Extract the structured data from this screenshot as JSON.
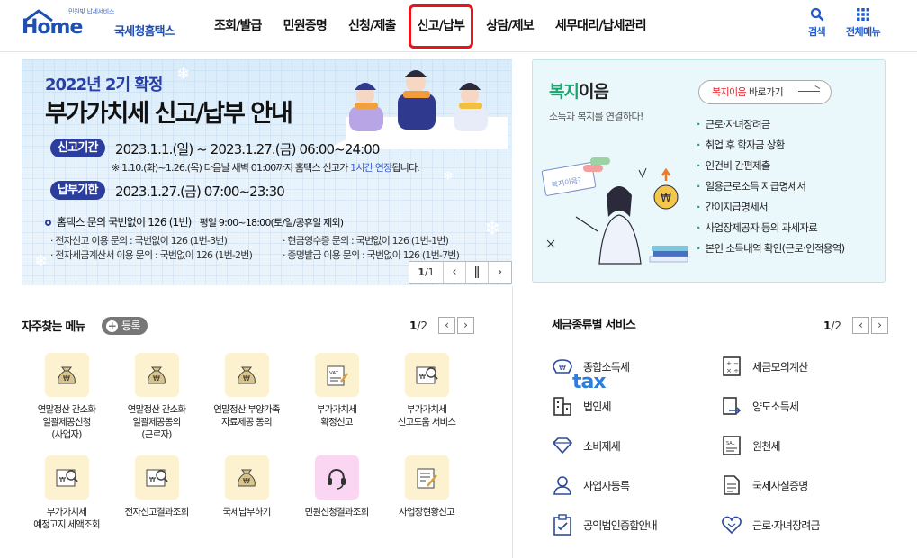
{
  "header": {
    "logo_small": "민원빛 납세서비스",
    "logo_home": "Home",
    "logo_tax": "tax",
    "logo_name": "국세청홈택스",
    "nav": [
      {
        "label": "조회/발급"
      },
      {
        "label": "민원증명"
      },
      {
        "label": "신청/제출"
      },
      {
        "label": "신고/납부"
      },
      {
        "label": "상담/제보"
      },
      {
        "label": "세무대리/납세관리"
      }
    ],
    "search_label": "검색",
    "all_menu_label": "전체메뉴"
  },
  "banner": {
    "year_line": "2022년 2기 확정",
    "title": "부가가치세 신고/납부 안내",
    "period_pill": "신고기간",
    "period_text": "2023.1.1.(일) ~ 2023.1.27.(금) 06:00~24:00",
    "note_prefix": "※ 1.10.(화)~1.26.(목) 다음날 새벽 01:00까지 홈택스 신고가 ",
    "note_highlight": "1시간 연장",
    "note_suffix": "됩니다.",
    "pay_pill": "납부기한",
    "pay_text": "2023.1.27.(금) 07:00~23:30",
    "info_main": "홈택스 문의  국번없이 126 (1번)",
    "info_hours": "평일 9:00~18:00(토/일/공휴일 제외)",
    "sub1": "· 전자신고 이용 문의 : 국번없이 126 (1번-3번)",
    "sub2": "· 전자세금계산서 이용 문의 : 국번없이 126 (1번-2번)",
    "sub3": "· 현금영수증 문의 : 국번없이 126 (1번-1번)",
    "sub4": "· 증명발급 이용 문의 : 국번없이 126 (1번-7번)",
    "pager_current": "1",
    "pager_total": "/1"
  },
  "welfare": {
    "title_green": "복지",
    "title_rest": "이음",
    "subtitle": "소득과 복지를 연결하다!",
    "link_red": "복지이음",
    "link_rest": " 바로가기",
    "illus_card": "복지이음?",
    "items": [
      {
        "label": "근로·자녀장려금"
      },
      {
        "label": "취업 후 학자금 상환"
      },
      {
        "label": "인건비 간편제출"
      },
      {
        "label": "일용근로소득 지급명세서"
      },
      {
        "label": "간이지급명세서"
      },
      {
        "label": "사업장제공자 등의 과세자료"
      },
      {
        "label": "본인 소득내역 확인(근로·인적용역)"
      }
    ]
  },
  "favorites": {
    "title": "자주찾는 메뉴",
    "add_label": "등록",
    "page_current": "1",
    "page_total": "/2",
    "items": [
      {
        "line1": "연말정산 간소화",
        "line2": "일괄제공신청",
        "line3": "(사업자)",
        "icon": "moneybag-icon"
      },
      {
        "line1": "연말정산 간소화",
        "line2": "일괄제공동의",
        "line3": "(근로자)",
        "icon": "moneybag-icon"
      },
      {
        "line1": "연말정산 부양가족",
        "line2": "자료제공 동의",
        "line3": "",
        "icon": "moneybag-icon"
      },
      {
        "line1": "부가가치세",
        "line2": "확정신고",
        "line3": "",
        "icon": "vat-doc-icon"
      },
      {
        "line1": "부가가치세",
        "line2": "신고도움 서비스",
        "line3": "",
        "icon": "search-doc-icon"
      },
      {
        "line1": "부가가치세",
        "line2": "예정고지 세액조회",
        "line3": "",
        "icon": "search-doc-icon"
      },
      {
        "line1": "전자신고결과조회",
        "line2": "",
        "line3": "",
        "icon": "search-doc-icon"
      },
      {
        "line1": "국세납부하기",
        "line2": "",
        "line3": "",
        "icon": "moneybag-icon"
      },
      {
        "line1": "민원신청결과조회",
        "line2": "",
        "line3": "",
        "icon": "headset-icon"
      },
      {
        "line1": "사업장현황신고",
        "line2": "",
        "line3": "",
        "icon": "edit-doc-icon"
      }
    ]
  },
  "tax_services": {
    "title": "세금종류별 서비스",
    "page_current": "1",
    "page_total": "/2",
    "items": [
      {
        "label": "종합소득세",
        "icon": "income-icon"
      },
      {
        "label": "세금모의계산",
        "icon": "calculator-icon"
      },
      {
        "label": "법인세",
        "icon": "building-icon"
      },
      {
        "label": "양도소득세",
        "icon": "transfer-icon"
      },
      {
        "label": "소비제세",
        "icon": "diamond-icon"
      },
      {
        "label": "원천세",
        "icon": "salary-icon"
      },
      {
        "label": "사업자등록",
        "icon": "person-icon"
      },
      {
        "label": "국세사실증명",
        "icon": "document-icon"
      },
      {
        "label": "공익법인종합안내",
        "icon": "clipboard-icon"
      },
      {
        "label": "근로·자녀장려금",
        "icon": "heart-icon"
      }
    ]
  },
  "colors": {
    "brand": "#1f4fb3",
    "highlight": "#e8131b",
    "welfare_green": "#1aa56e"
  }
}
